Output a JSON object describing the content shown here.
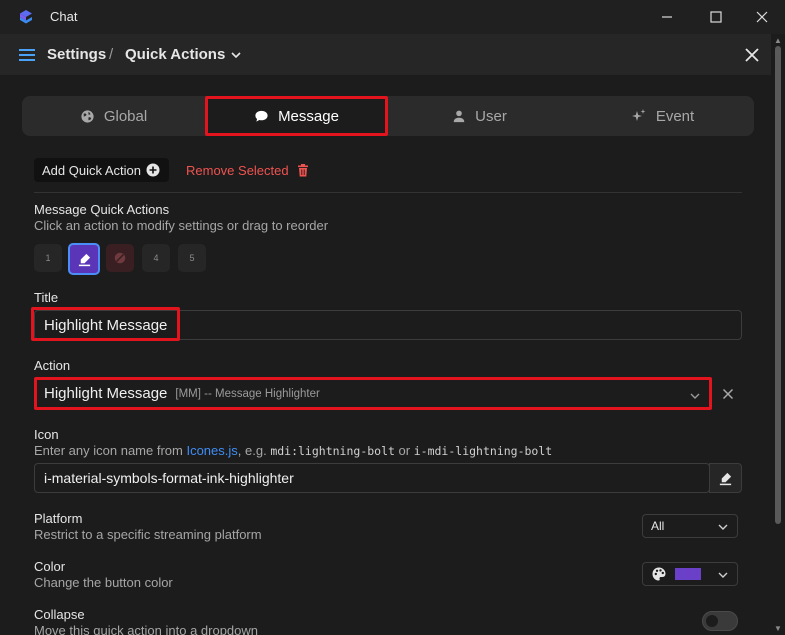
{
  "window": {
    "title": "Chat",
    "controls": {
      "minimize": "—",
      "maximize": "☐",
      "close": "✕"
    }
  },
  "header": {
    "breadcrumb": [
      "Settings",
      "/",
      "Quick Actions"
    ],
    "close_label": "✕"
  },
  "tabs": [
    {
      "label": "Global",
      "icon": "globe-icon"
    },
    {
      "label": "Message",
      "icon": "chat-bubble-icon",
      "selected": true
    },
    {
      "label": "User",
      "icon": "person-icon"
    },
    {
      "label": "Event",
      "icon": "sparkles-icon"
    }
  ],
  "toolbar": {
    "add_label": "Add Quick Action",
    "remove_label": "Remove Selected"
  },
  "quick_actions": {
    "label": "Message Quick Actions",
    "hint": "Click an action to modify settings or drag to reorder",
    "slots": [
      "1",
      "",
      "",
      "4",
      "5"
    ],
    "selected_index": 1
  },
  "title_field": {
    "label": "Title",
    "value": "Highlight Message"
  },
  "action_field": {
    "label": "Action",
    "value": "Highlight Message",
    "detail": "[MM] -- Message Highlighter"
  },
  "icon_field": {
    "label": "Icon",
    "hint_prefix": "Enter any icon name from ",
    "hint_link": "Icones.js",
    "hint_mid": ", e.g. ",
    "example_1": "mdi:lightning-bolt",
    "hint_or": " or ",
    "example_2": "i-mdi-lightning-bolt",
    "value": "i-material-symbols-format-ink-highlighter"
  },
  "platform": {
    "label": "Platform",
    "hint": "Restrict to a specific streaming platform",
    "value": "All"
  },
  "color": {
    "label": "Color",
    "hint": "Change the button color",
    "value": "#6a40c8"
  },
  "collapse": {
    "label": "Collapse",
    "hint": "Move this quick action into a dropdown",
    "enabled": false
  },
  "colors": {
    "accent": "#4b8ef7",
    "highlight_red": "#e3141e",
    "danger": "#ef5350",
    "selected_slot": "#5b35b8"
  }
}
